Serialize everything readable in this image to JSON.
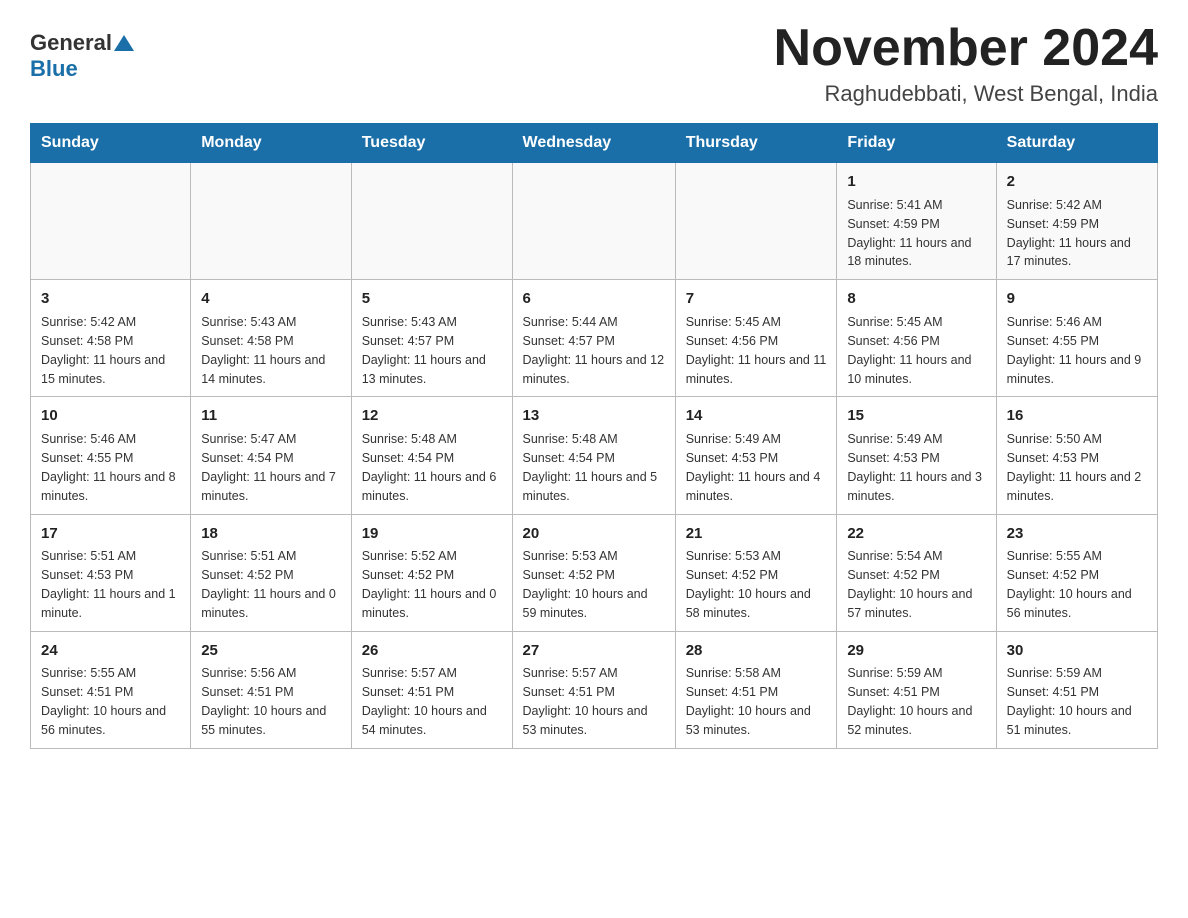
{
  "header": {
    "logo_general": "General",
    "logo_blue": "Blue",
    "month_title": "November 2024",
    "location": "Raghudebbati, West Bengal, India"
  },
  "weekdays": [
    "Sunday",
    "Monday",
    "Tuesday",
    "Wednesday",
    "Thursday",
    "Friday",
    "Saturday"
  ],
  "weeks": [
    [
      {
        "day": "",
        "info": ""
      },
      {
        "day": "",
        "info": ""
      },
      {
        "day": "",
        "info": ""
      },
      {
        "day": "",
        "info": ""
      },
      {
        "day": "",
        "info": ""
      },
      {
        "day": "1",
        "info": "Sunrise: 5:41 AM\nSunset: 4:59 PM\nDaylight: 11 hours and 18 minutes."
      },
      {
        "day": "2",
        "info": "Sunrise: 5:42 AM\nSunset: 4:59 PM\nDaylight: 11 hours and 17 minutes."
      }
    ],
    [
      {
        "day": "3",
        "info": "Sunrise: 5:42 AM\nSunset: 4:58 PM\nDaylight: 11 hours and 15 minutes."
      },
      {
        "day": "4",
        "info": "Sunrise: 5:43 AM\nSunset: 4:58 PM\nDaylight: 11 hours and 14 minutes."
      },
      {
        "day": "5",
        "info": "Sunrise: 5:43 AM\nSunset: 4:57 PM\nDaylight: 11 hours and 13 minutes."
      },
      {
        "day": "6",
        "info": "Sunrise: 5:44 AM\nSunset: 4:57 PM\nDaylight: 11 hours and 12 minutes."
      },
      {
        "day": "7",
        "info": "Sunrise: 5:45 AM\nSunset: 4:56 PM\nDaylight: 11 hours and 11 minutes."
      },
      {
        "day": "8",
        "info": "Sunrise: 5:45 AM\nSunset: 4:56 PM\nDaylight: 11 hours and 10 minutes."
      },
      {
        "day": "9",
        "info": "Sunrise: 5:46 AM\nSunset: 4:55 PM\nDaylight: 11 hours and 9 minutes."
      }
    ],
    [
      {
        "day": "10",
        "info": "Sunrise: 5:46 AM\nSunset: 4:55 PM\nDaylight: 11 hours and 8 minutes."
      },
      {
        "day": "11",
        "info": "Sunrise: 5:47 AM\nSunset: 4:54 PM\nDaylight: 11 hours and 7 minutes."
      },
      {
        "day": "12",
        "info": "Sunrise: 5:48 AM\nSunset: 4:54 PM\nDaylight: 11 hours and 6 minutes."
      },
      {
        "day": "13",
        "info": "Sunrise: 5:48 AM\nSunset: 4:54 PM\nDaylight: 11 hours and 5 minutes."
      },
      {
        "day": "14",
        "info": "Sunrise: 5:49 AM\nSunset: 4:53 PM\nDaylight: 11 hours and 4 minutes."
      },
      {
        "day": "15",
        "info": "Sunrise: 5:49 AM\nSunset: 4:53 PM\nDaylight: 11 hours and 3 minutes."
      },
      {
        "day": "16",
        "info": "Sunrise: 5:50 AM\nSunset: 4:53 PM\nDaylight: 11 hours and 2 minutes."
      }
    ],
    [
      {
        "day": "17",
        "info": "Sunrise: 5:51 AM\nSunset: 4:53 PM\nDaylight: 11 hours and 1 minute."
      },
      {
        "day": "18",
        "info": "Sunrise: 5:51 AM\nSunset: 4:52 PM\nDaylight: 11 hours and 0 minutes."
      },
      {
        "day": "19",
        "info": "Sunrise: 5:52 AM\nSunset: 4:52 PM\nDaylight: 11 hours and 0 minutes."
      },
      {
        "day": "20",
        "info": "Sunrise: 5:53 AM\nSunset: 4:52 PM\nDaylight: 10 hours and 59 minutes."
      },
      {
        "day": "21",
        "info": "Sunrise: 5:53 AM\nSunset: 4:52 PM\nDaylight: 10 hours and 58 minutes."
      },
      {
        "day": "22",
        "info": "Sunrise: 5:54 AM\nSunset: 4:52 PM\nDaylight: 10 hours and 57 minutes."
      },
      {
        "day": "23",
        "info": "Sunrise: 5:55 AM\nSunset: 4:52 PM\nDaylight: 10 hours and 56 minutes."
      }
    ],
    [
      {
        "day": "24",
        "info": "Sunrise: 5:55 AM\nSunset: 4:51 PM\nDaylight: 10 hours and 56 minutes."
      },
      {
        "day": "25",
        "info": "Sunrise: 5:56 AM\nSunset: 4:51 PM\nDaylight: 10 hours and 55 minutes."
      },
      {
        "day": "26",
        "info": "Sunrise: 5:57 AM\nSunset: 4:51 PM\nDaylight: 10 hours and 54 minutes."
      },
      {
        "day": "27",
        "info": "Sunrise: 5:57 AM\nSunset: 4:51 PM\nDaylight: 10 hours and 53 minutes."
      },
      {
        "day": "28",
        "info": "Sunrise: 5:58 AM\nSunset: 4:51 PM\nDaylight: 10 hours and 53 minutes."
      },
      {
        "day": "29",
        "info": "Sunrise: 5:59 AM\nSunset: 4:51 PM\nDaylight: 10 hours and 52 minutes."
      },
      {
        "day": "30",
        "info": "Sunrise: 5:59 AM\nSunset: 4:51 PM\nDaylight: 10 hours and 51 minutes."
      }
    ]
  ]
}
